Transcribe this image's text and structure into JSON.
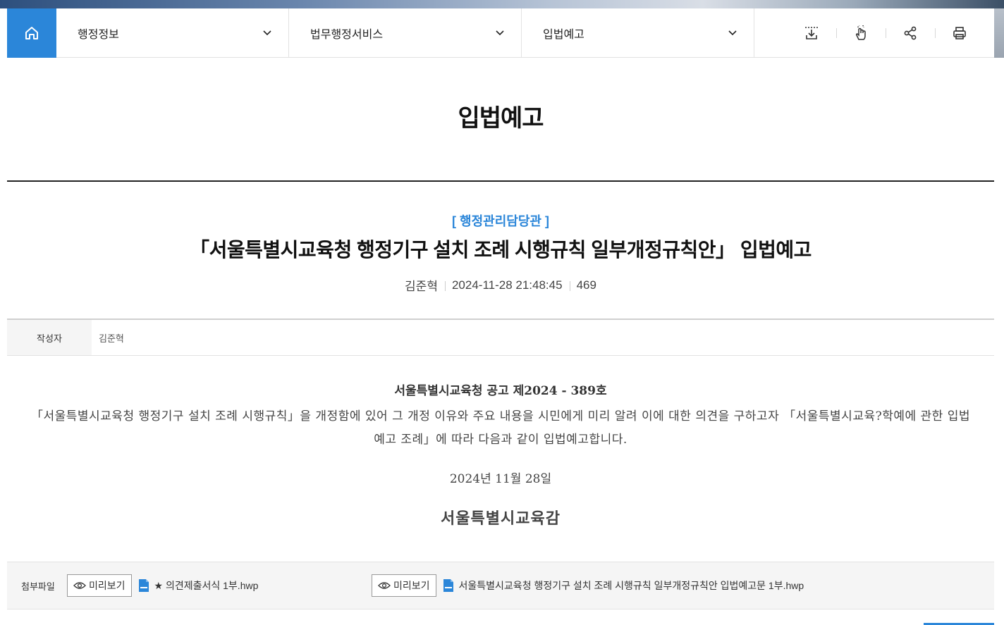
{
  "nav": {
    "home_icon": "home-icon",
    "menus": [
      {
        "label": "행정정보"
      },
      {
        "label": "법무행정서비스"
      },
      {
        "label": "입법예고"
      }
    ],
    "tools": [
      "download-icon",
      "touch-icon",
      "share-icon",
      "print-icon"
    ]
  },
  "page": {
    "title": "입법예고"
  },
  "post": {
    "department": "[ 행정관리담당관 ]",
    "title": "「서울특별시교육청 행정기구 설치 조례 시행규칙 일부개정규칙안」 입법예고",
    "author": "김준혁",
    "datetime": "2024-11-28 21:48:45",
    "views": "469"
  },
  "info": {
    "author_label": "작성자",
    "author_value": "김준혁"
  },
  "content": {
    "notice_number": "서울특별시교육청 공고 제2024 - 389호",
    "body": "「서울특별시교육청 행정기구 설치 조례 시행규칙」을 개정함에 있어 그 개정 이유와 주요 내용을 시민에게 미리 알려 이에 대한 의견을 구하고자 「서울특별시교육?학예에 관한 입법예고 조례」에 따라 다음과 같이 입법예고합니다.",
    "date": "2024년 11월 28일",
    "signature": "서울특별시교육감"
  },
  "attachments": {
    "label": "첨부파일",
    "preview_label": "미리보기",
    "files": [
      {
        "name": "★ 의견제출서식 1부.hwp"
      },
      {
        "name": "서울특별시교육청 행정기구 설치 조례 시행규칙 일부개정규칙안 입법예고문 1부.hwp"
      }
    ]
  },
  "colors": {
    "accent": "#2b86d9",
    "title_rule": "#222222"
  }
}
